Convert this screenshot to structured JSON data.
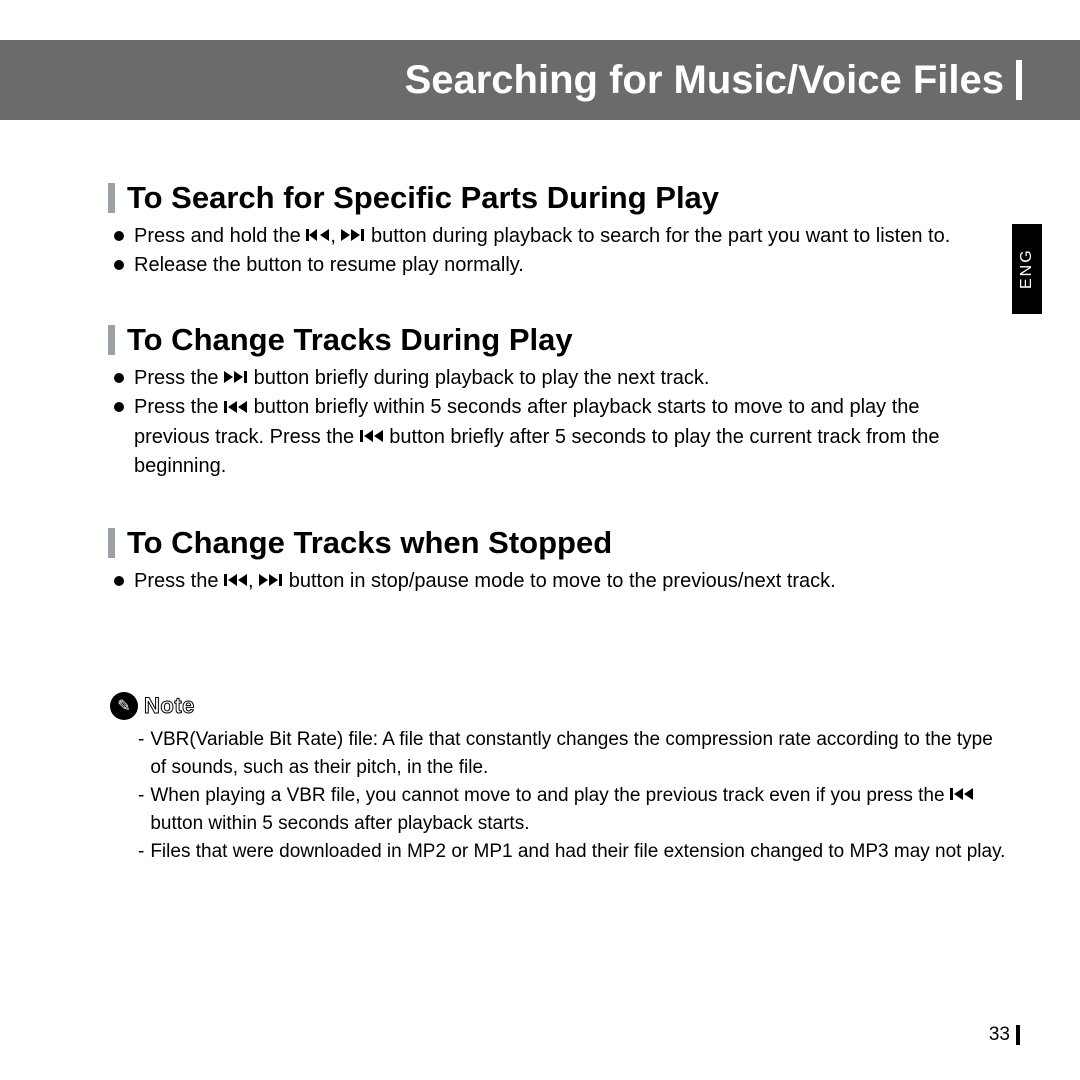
{
  "header": {
    "title": "Searching for Music/Voice Files"
  },
  "lang_tab": "ENG",
  "sections": [
    {
      "title": "To Search for Specific Parts During Play",
      "bullets": [
        {
          "pre": "Press and hold the ",
          "icons": [
            "prev",
            "next"
          ],
          "sep": ",",
          "post": " button during playback to search for the part you want to listen to."
        },
        {
          "pre": "Release the button to resume play normally.",
          "icons": [],
          "sep": "",
          "post": ""
        }
      ]
    },
    {
      "title": "To Change Tracks During Play",
      "bullets": [
        {
          "pre": "Press the ",
          "icons": [
            "next"
          ],
          "sep": "",
          "post": " button briefly during playback to play the next track."
        },
        {
          "pre": "Press the ",
          "icons": [
            "prev"
          ],
          "sep": "",
          "post": " button briefly within 5 seconds after playback starts to move to and play the previous track. Press the ",
          "icons2": [
            "prev"
          ],
          "post2": " button briefly after 5 seconds to play the current track from the beginning."
        }
      ]
    },
    {
      "title": "To Change Tracks when Stopped",
      "bullets": [
        {
          "pre": "Press the ",
          "icons": [
            "prev",
            "next"
          ],
          "sep": ",",
          "post": " button in stop/pause mode to move to the previous/next track."
        }
      ]
    }
  ],
  "note": {
    "label": "Note",
    "lines": [
      "VBR(Variable Bit Rate) file: A file that constantly changes the compression rate according to the type of sounds, such as their pitch, in the file.",
      "When playing a VBR file, you cannot move to and play the previous track even if you press the [ICON_PREV] button within 5 seconds after playback starts.",
      "Files that were downloaded in MP2 or MP1 and had their file extension changed to MP3 may not play."
    ]
  },
  "page_number": "33"
}
